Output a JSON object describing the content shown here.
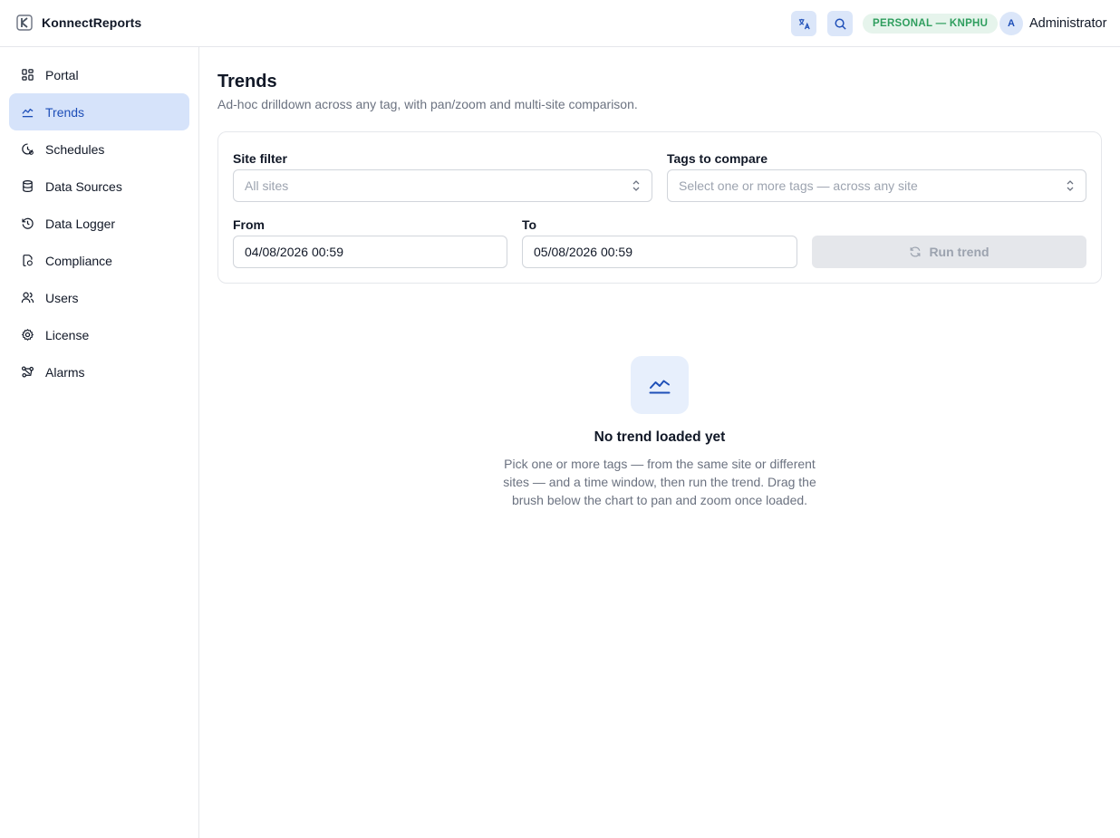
{
  "app": {
    "name": "KonnectReports"
  },
  "header": {
    "license_badge": "PERSONAL — KNPHU",
    "avatar_initial": "A",
    "user_name": "Administrator"
  },
  "sidebar": {
    "items": [
      {
        "label": "Portal",
        "icon": "grid-icon"
      },
      {
        "label": "Trends",
        "icon": "trend-line-icon",
        "active": true
      },
      {
        "label": "Schedules",
        "icon": "clock-icon"
      },
      {
        "label": "Data Sources",
        "icon": "database-icon"
      },
      {
        "label": "Data Logger",
        "icon": "history-icon"
      },
      {
        "label": "Compliance",
        "icon": "document-check-icon"
      },
      {
        "label": "Users",
        "icon": "users-icon"
      },
      {
        "label": "License",
        "icon": "gear-icon"
      },
      {
        "label": "Alarms",
        "icon": "share-nodes-icon"
      }
    ]
  },
  "page": {
    "title": "Trends",
    "subtitle": "Ad-hoc drilldown across any tag, with pan/zoom and multi-site comparison."
  },
  "form": {
    "site_filter_label": "Site filter",
    "site_filter_placeholder": "All sites",
    "tags_label": "Tags to compare",
    "tags_placeholder": "Select one or more tags — across any site",
    "from_label": "From",
    "from_value": "04/08/2026 00:59",
    "to_label": "To",
    "to_value": "05/08/2026 00:59",
    "run_button": "Run trend"
  },
  "empty_state": {
    "title": "No trend loaded yet",
    "description": "Pick one or more tags — from the same site or different sites — and a time window, then run the trend. Drag the brush below the chart to pan and zoom once loaded."
  },
  "colors": {
    "accent": "#1e4fb8",
    "active_bg": "#d6e3fa",
    "badge_text": "#2f9e5e",
    "badge_bg": "#e6f4ec"
  }
}
